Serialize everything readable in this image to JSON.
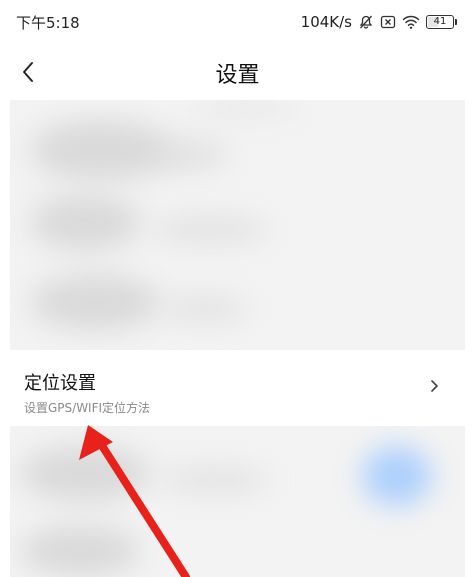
{
  "status_bar": {
    "time": "下午5:18",
    "network_speed": "104K/s",
    "icons": [
      "bell-off-icon",
      "close-box-icon",
      "wifi-icon"
    ],
    "battery": "41",
    "battery_level": 0.41
  },
  "header": {
    "back_icon": "chevron-left-icon",
    "title": "设置"
  },
  "settings": {
    "location_item": {
      "title": "定位设置",
      "subtitle": "设置GPS/WIFI定位方法",
      "chevron_icon": "chevron-right-icon"
    }
  },
  "annotation": {
    "arrow_color": "#e8211b"
  },
  "colors": {
    "background": "#ffffff",
    "blurred_section": "#f3f3f3",
    "subtitle": "#8a8a8a"
  }
}
